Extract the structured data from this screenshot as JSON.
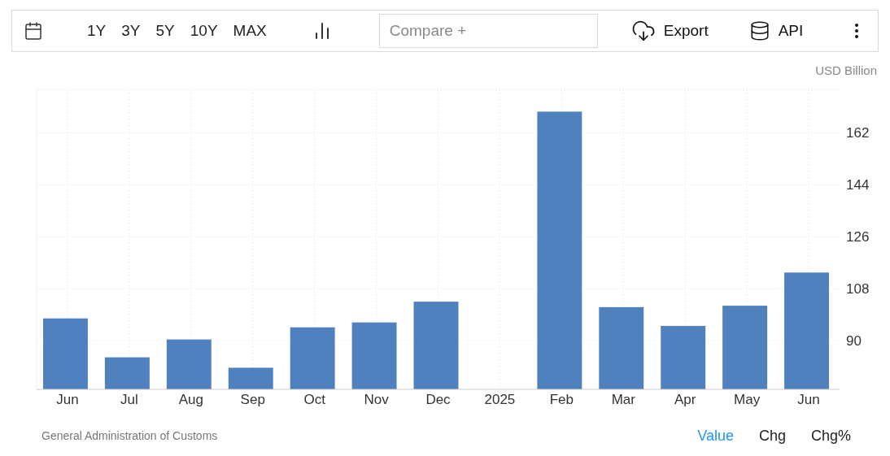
{
  "toolbar": {
    "ranges": [
      "1Y",
      "3Y",
      "5Y",
      "10Y",
      "MAX"
    ],
    "compare": {
      "placeholder": "Compare +"
    },
    "export": "Export",
    "api": "API"
  },
  "unit": "USD Billion",
  "chart": {
    "chart_data": {
      "type": "bar",
      "categories": [
        "Jun",
        "Jul",
        "Aug",
        "Sep",
        "Oct",
        "Nov",
        "Dec",
        "2025",
        "Feb",
        "Mar",
        "Apr",
        "May",
        "Jun"
      ],
      "grid": true,
      "series": [
        {
          "color": "#4e81bd",
          "values": [
            97.6,
            84.1,
            90.3,
            80.5,
            94.5,
            96.2,
            103.4,
            null,
            169.3,
            101.5,
            95.0,
            102.0,
            113.5
          ]
        }
      ],
      "ylim": [
        73,
        177
      ],
      "yticks": [
        90,
        108,
        126,
        144,
        162
      ]
    }
  },
  "source": "General Administration of Customs",
  "views": [
    {
      "label": "Value",
      "selected": true
    },
    {
      "label": "Chg",
      "selected": false
    },
    {
      "label": "Chg%",
      "selected": false
    }
  ]
}
